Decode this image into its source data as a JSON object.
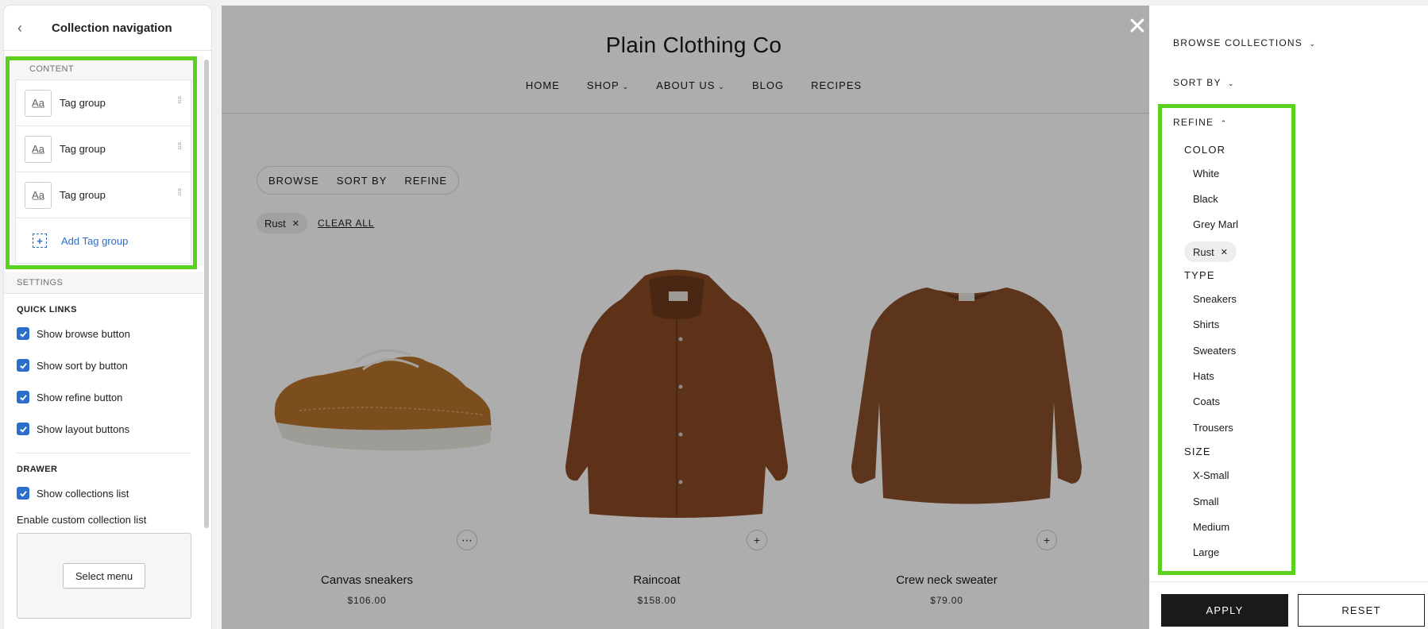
{
  "editor": {
    "title": "Collection navigation",
    "content_label": "CONTENT",
    "tag_groups": [
      {
        "label": "Tag group"
      },
      {
        "label": "Tag group"
      },
      {
        "label": "Tag group"
      }
    ],
    "add_label": "Add Tag group",
    "settings_label": "SETTINGS",
    "quick_links_heading": "QUICK LINKS",
    "quick_links": [
      {
        "label": "Show browse button",
        "checked": true
      },
      {
        "label": "Show sort by button",
        "checked": true
      },
      {
        "label": "Show refine button",
        "checked": true
      },
      {
        "label": "Show layout buttons",
        "checked": true
      }
    ],
    "drawer_heading": "DRAWER",
    "drawer_option": {
      "label": "Show collections list",
      "checked": true
    },
    "custom_list_label": "Enable custom collection list",
    "select_menu_label": "Select menu",
    "highlight_color": "#5ad11e",
    "accent_color": "#2c6ecb"
  },
  "store": {
    "title": "Plain Clothing Co",
    "nav": [
      {
        "label": "HOME",
        "dropdown": false
      },
      {
        "label": "SHOP",
        "dropdown": true
      },
      {
        "label": "ABOUT US",
        "dropdown": true
      },
      {
        "label": "BLOG",
        "dropdown": false
      },
      {
        "label": "RECIPES",
        "dropdown": false
      }
    ],
    "filter_bar": {
      "browse": "BROWSE",
      "sort": "SORT BY",
      "refine": "REFINE"
    },
    "active_filter": "Rust",
    "clear_all": "CLEAR ALL",
    "products": [
      {
        "name": "Canvas sneakers",
        "price": "$106.00",
        "action_icon": "ellipsis-icon"
      },
      {
        "name": "Raincoat",
        "price": "$158.00",
        "action_icon": "plus-icon"
      },
      {
        "name": "Crew neck sweater",
        "price": "$79.00",
        "action_icon": "plus-icon"
      }
    ]
  },
  "drawer": {
    "browse_collections": "BROWSE COLLECTIONS",
    "sort_by": "SORT BY",
    "refine": "REFINE",
    "color_title": "COLOR",
    "colors": [
      "White",
      "Black",
      "Grey Marl"
    ],
    "selected_color": "Rust",
    "type_title": "TYPE",
    "types": [
      "Sneakers",
      "Shirts",
      "Sweaters",
      "Hats",
      "Coats",
      "Trousers"
    ],
    "size_title": "SIZE",
    "sizes": [
      "X-Small",
      "Small",
      "Medium",
      "Large"
    ],
    "apply": "APPLY",
    "reset": "RESET"
  }
}
